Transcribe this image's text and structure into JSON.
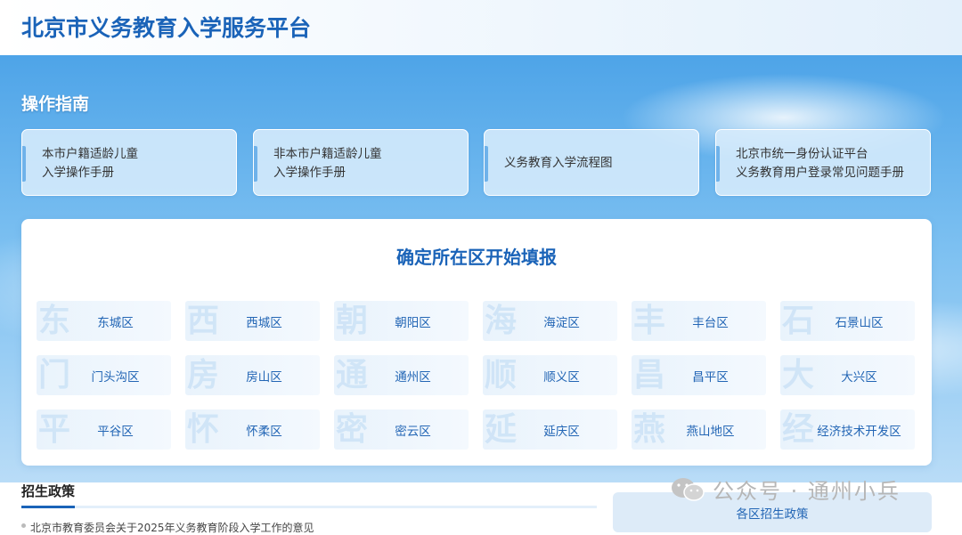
{
  "header": {
    "title": "北京市义务教育入学服务平台"
  },
  "guide": {
    "title": "操作指南",
    "cards": [
      {
        "line1": "本市户籍适龄儿童",
        "line2": "入学操作手册"
      },
      {
        "line1": "非本市户籍适龄儿童",
        "line2": "入学操作手册"
      },
      {
        "line1": "义务教育入学流程图",
        "line2": ""
      },
      {
        "line1": "北京市统一身份认证平台",
        "line2": "义务教育用户登录常见问题手册"
      }
    ]
  },
  "district_panel": {
    "title": "确定所在区开始填报",
    "districts": [
      {
        "glyph": "东",
        "label": "东城区"
      },
      {
        "glyph": "西",
        "label": "西城区"
      },
      {
        "glyph": "朝",
        "label": "朝阳区"
      },
      {
        "glyph": "海",
        "label": "海淀区"
      },
      {
        "glyph": "丰",
        "label": "丰台区"
      },
      {
        "glyph": "石",
        "label": "石景山区"
      },
      {
        "glyph": "门",
        "label": "门头沟区"
      },
      {
        "glyph": "房",
        "label": "房山区"
      },
      {
        "glyph": "通",
        "label": "通州区"
      },
      {
        "glyph": "顺",
        "label": "顺义区"
      },
      {
        "glyph": "昌",
        "label": "昌平区"
      },
      {
        "glyph": "大",
        "label": "大兴区"
      },
      {
        "glyph": "平",
        "label": "平谷区"
      },
      {
        "glyph": "怀",
        "label": "怀柔区"
      },
      {
        "glyph": "密",
        "label": "密云区"
      },
      {
        "glyph": "延",
        "label": "延庆区"
      },
      {
        "glyph": "燕",
        "label": "燕山地区"
      },
      {
        "glyph": "经",
        "label": "经济技术开发区"
      }
    ]
  },
  "policy": {
    "title": "招生政策",
    "first_item": "北京市教育委员会关于2025年义务教育阶段入学工作的意见",
    "side_box_label": "各区招生政策"
  },
  "watermark": {
    "text": "公众号 · 通州小兵",
    "icon": "wechat-icon"
  },
  "colors": {
    "brand": "#1a63b8",
    "sky": "#4ea4e8",
    "link": "#2366b5"
  }
}
